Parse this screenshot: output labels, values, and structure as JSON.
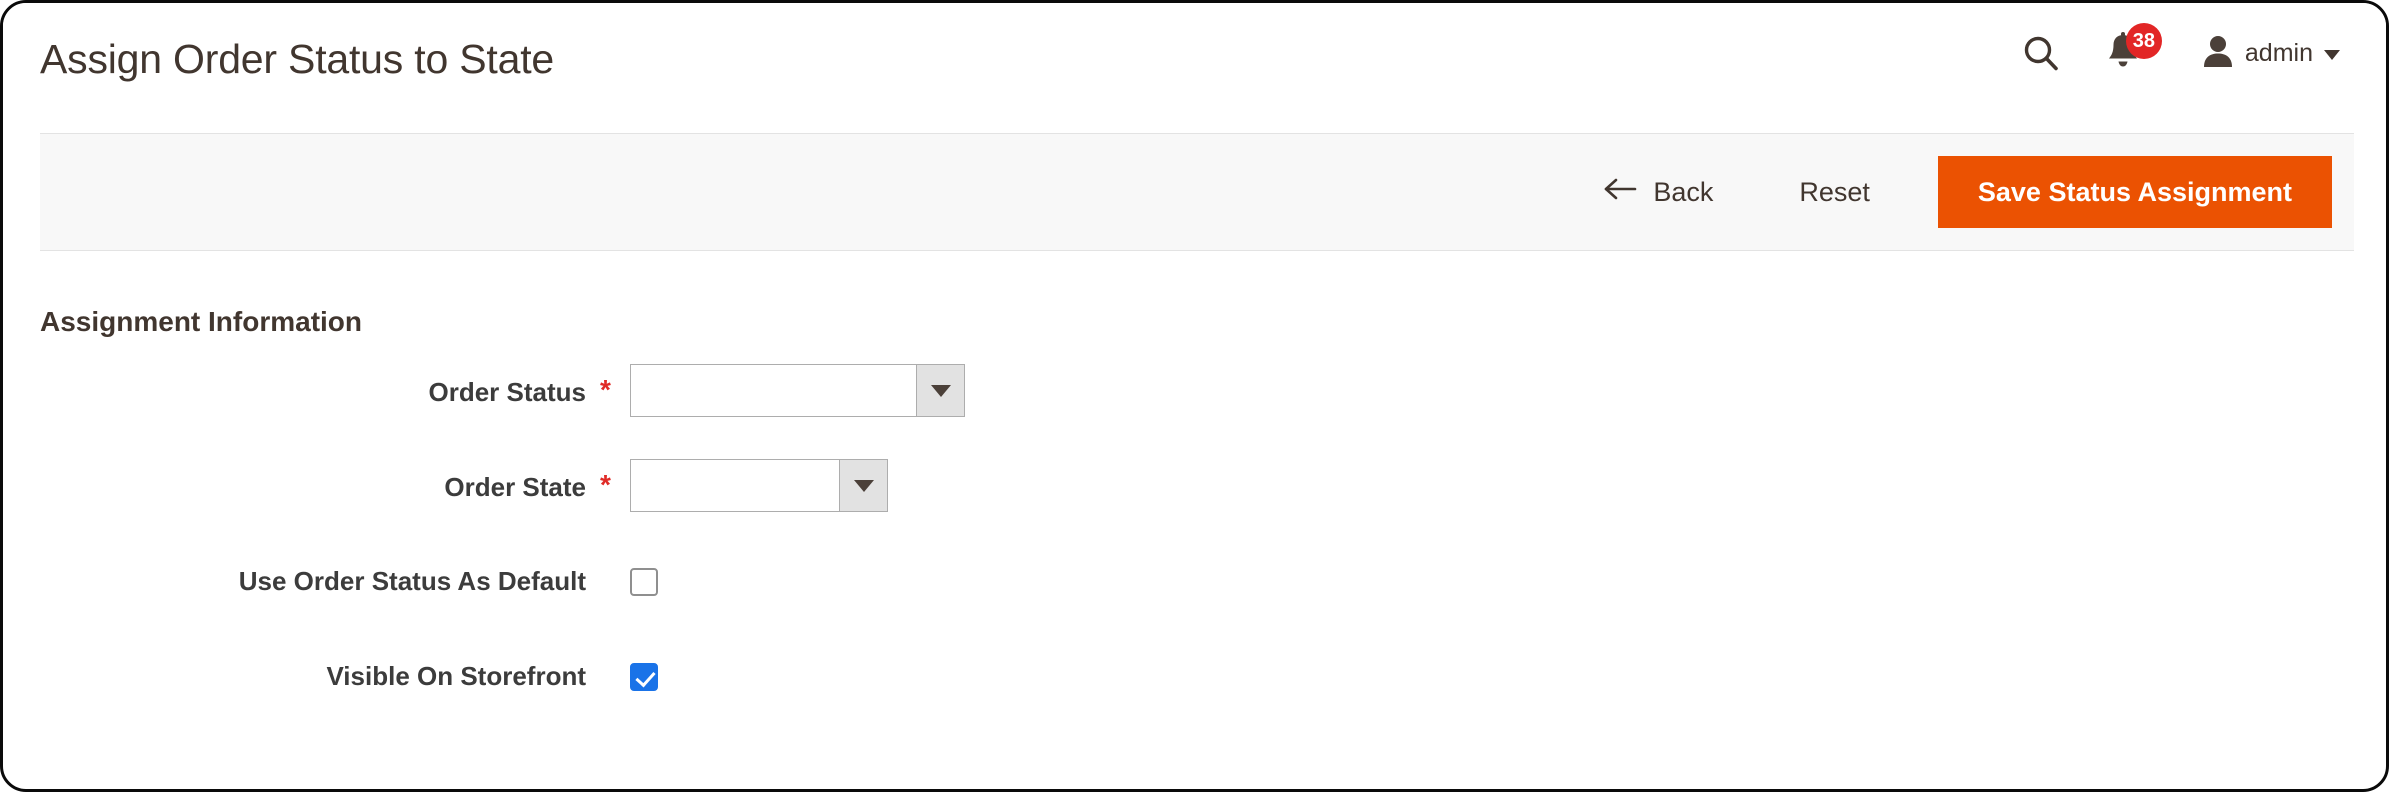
{
  "header": {
    "title": "Assign Order Status to State",
    "search_icon": "search-icon",
    "notifications_icon": "bell-icon",
    "notifications_count": "38",
    "user_icon": "user-avatar-icon",
    "user_name": "admin",
    "user_caret_icon": "chevron-down-icon"
  },
  "action_bar": {
    "back_label": "Back",
    "back_icon": "arrow-left-icon",
    "reset_label": "Reset",
    "save_label": "Save Status Assignment",
    "save_color": "#eb5202",
    "bar_background": "#f8f8f8"
  },
  "form": {
    "section_title": "Assignment Information",
    "fields": [
      {
        "label": "Order Status",
        "required": "*",
        "type": "select",
        "value": "",
        "arrow_icon": "triangle-down-icon"
      },
      {
        "label": "Order State",
        "required": "*",
        "type": "select",
        "value": "",
        "arrow_icon": "triangle-down-icon"
      },
      {
        "label": "Use Order Status As Default",
        "required": "",
        "type": "checkbox",
        "checked": false
      },
      {
        "label": "Visible On Storefront",
        "required": "",
        "type": "checkbox",
        "checked": true
      }
    ]
  },
  "colors": {
    "accent_orange": "#eb5202",
    "badge_red": "#e22626",
    "checkbox_blue": "#1a73e8",
    "required_red": "#e02b27",
    "text_dark": "#41362f"
  }
}
